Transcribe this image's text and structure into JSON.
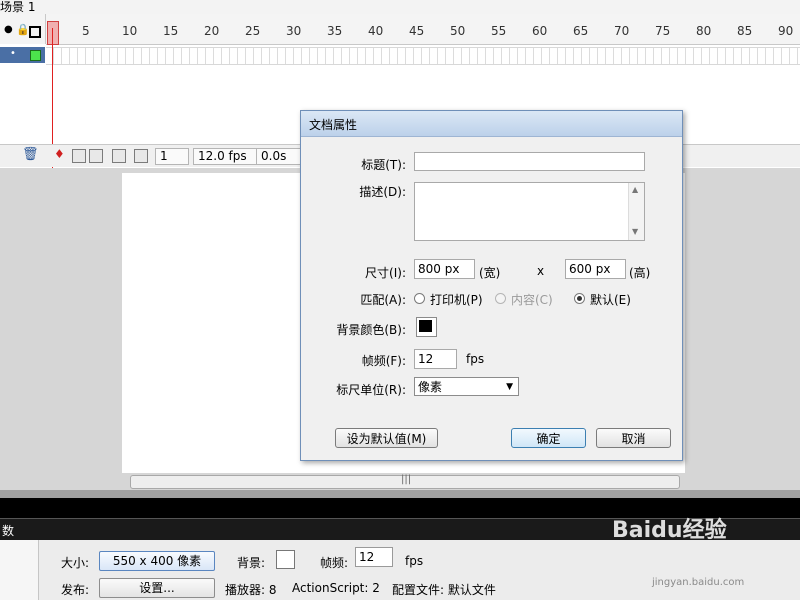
{
  "scene": {
    "label": "场景 1"
  },
  "timeline": {
    "ruler_ticks": [
      "1",
      "5",
      "10",
      "15",
      "20",
      "25",
      "30",
      "35",
      "40",
      "45",
      "50",
      "55",
      "60",
      "65",
      "70",
      "75",
      "80",
      "85",
      "90"
    ],
    "current_frame": "1",
    "frame_rate": "12.0 fps",
    "elapsed_time": "0.0s"
  },
  "dialog": {
    "title": "文档属性",
    "title_label": "标题(T):",
    "title_value": "",
    "description_label": "描述(D):",
    "description_value": "",
    "dimensions_label": "尺寸(I):",
    "width_value": "800 px",
    "width_suffix": "(宽)",
    "x_separator": "x",
    "height_value": "600 px",
    "height_suffix": "(高)",
    "match_label": "匹配(A):",
    "match_options": [
      {
        "label": "打印机(P)",
        "selected": false,
        "disabled": false
      },
      {
        "label": "内容(C)",
        "selected": false,
        "disabled": true
      },
      {
        "label": "默认(E)",
        "selected": true,
        "disabled": false
      }
    ],
    "bg_color_label": "背景颜色(B):",
    "bg_color": "#000000",
    "frame_rate_label": "帧频(F):",
    "frame_rate_value": "12",
    "frame_rate_unit": "fps",
    "ruler_units_label": "标尺单位(R):",
    "ruler_units_value": "像素",
    "make_default_button": "设为默认值(M)",
    "ok_button": "确定",
    "cancel_button": "取消"
  },
  "properties": {
    "panel_title": "数",
    "size_label": "大小:",
    "size_button": "550 x 400 像素",
    "background_label": "背景:",
    "frame_rate_label": "帧频:",
    "frame_rate_value": "12",
    "frame_rate_unit": "fps",
    "publish_label": "发布:",
    "settings_button": "设置...",
    "player_text": "播放器: 8",
    "actionscript_text": "ActionScript: 2",
    "profile_text": "配置文件: 默认文件"
  },
  "watermark": {
    "text": "Baidu经验",
    "sub": "jingyan.baidu.com"
  }
}
